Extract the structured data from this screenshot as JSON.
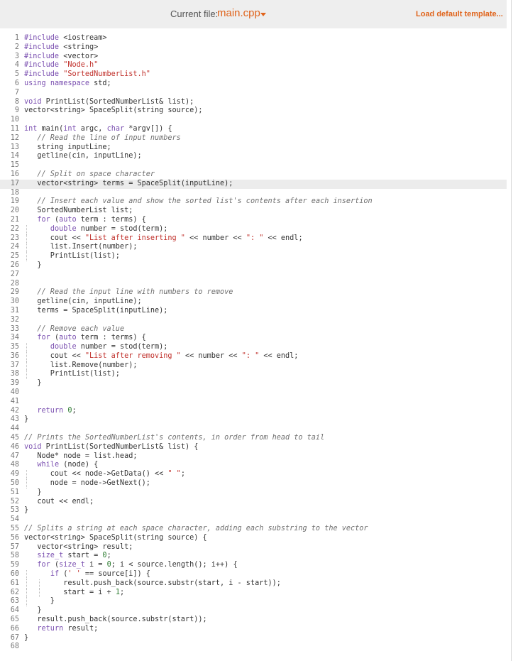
{
  "header": {
    "current_file_label": "Current file:",
    "file_name": "main.cpp",
    "load_template_label": "Load default template..."
  },
  "colors": {
    "accent": "#e0641c",
    "keyword": "#7a4fb0",
    "string": "#c0302b",
    "comment": "#6f6f6f",
    "number": "#2e7d32"
  },
  "editor": {
    "active_line": 17,
    "lines": [
      "#include <iostream>",
      "#include <string>",
      "#include <vector>",
      "#include \"Node.h\"",
      "#include \"SortedNumberList.h\"",
      "using namespace std;",
      "",
      "void PrintList(SortedNumberList& list);",
      "vector<string> SpaceSplit(string source);",
      "",
      "int main(int argc, char *argv[]) {",
      "   // Read the line of input numbers",
      "   string inputLine;",
      "   getline(cin, inputLine);",
      "",
      "   // Split on space character",
      "   vector<string> terms = SpaceSplit(inputLine);",
      "",
      "   // Insert each value and show the sorted list's contents after each insertion",
      "   SortedNumberList list;",
      "   for (auto term : terms) {",
      "      double number = stod(term);",
      "      cout << \"List after inserting \" << number << \": \" << endl;",
      "      list.Insert(number);",
      "      PrintList(list);",
      "   }",
      "",
      "",
      "   // Read the input line with numbers to remove",
      "   getline(cin, inputLine);",
      "   terms = SpaceSplit(inputLine);",
      "",
      "   // Remove each value",
      "   for (auto term : terms) {",
      "      double number = stod(term);",
      "      cout << \"List after removing \" << number << \": \" << endl;",
      "      list.Remove(number);",
      "      PrintList(list);",
      "   }",
      "",
      "",
      "   return 0;",
      "}",
      "",
      "// Prints the SortedNumberList's contents, in order from head to tail",
      "void PrintList(SortedNumberList& list) {",
      "   Node* node = list.head;",
      "   while (node) {",
      "      cout << node->GetData() << \" \";",
      "      node = node->GetNext();",
      "   }",
      "   cout << endl;",
      "}",
      "",
      "// Splits a string at each space character, adding each substring to the vector",
      "vector<string> SpaceSplit(string source) {",
      "   vector<string> result;",
      "   size_t start = 0;",
      "   for (size_t i = 0; i < source.length(); i++) {",
      "      if (' ' == source[i]) {",
      "         result.push_back(source.substr(start, i - start));",
      "         start = i + 1;",
      "      }",
      "   }",
      "   result.push_back(source.substr(start));",
      "   return result;",
      "}",
      ""
    ]
  }
}
